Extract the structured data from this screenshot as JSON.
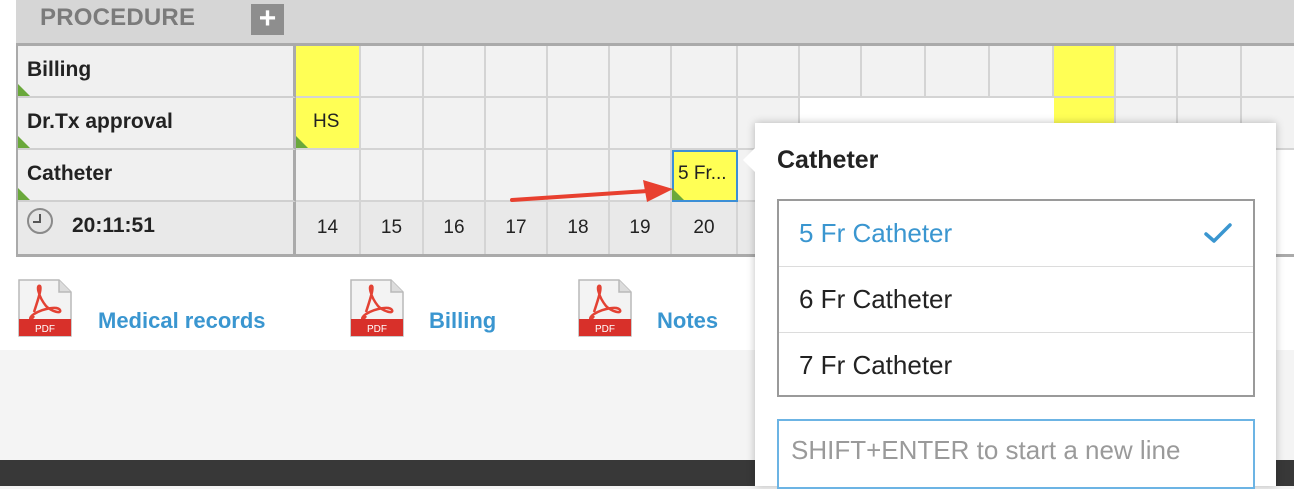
{
  "section": {
    "title": "PROCEDURE",
    "add_label": "+"
  },
  "rows": [
    {
      "label": "Billing"
    },
    {
      "label": "Dr.Tx approval",
      "cell_text": "HS"
    },
    {
      "label": "Catheter",
      "cell_text": "5 Fr..."
    }
  ],
  "clock": {
    "time": "20:11:51"
  },
  "dates": [
    "14",
    "15",
    "16",
    "17",
    "18",
    "19",
    "20"
  ],
  "documents": [
    {
      "icon": "pdf-icon",
      "badge": "PDF",
      "label": "Medical records"
    },
    {
      "icon": "pdf-icon",
      "badge": "PDF",
      "label": "Billing"
    },
    {
      "icon": "pdf-icon",
      "badge": "PDF",
      "label": "Notes"
    }
  ],
  "popup": {
    "title": "Catheter",
    "options": [
      "5 Fr Catheter",
      "6 Fr Catheter",
      "7 Fr Catheter"
    ],
    "selected_option": "5 Fr Catheter",
    "note_placeholder": "SHIFT+ENTER to start a new line"
  },
  "colors": {
    "highlight_yellow": "#ffff55",
    "accent_blue": "#3a96d0",
    "flag_green": "#6aa83b",
    "arrow_red": "#e8402f"
  }
}
